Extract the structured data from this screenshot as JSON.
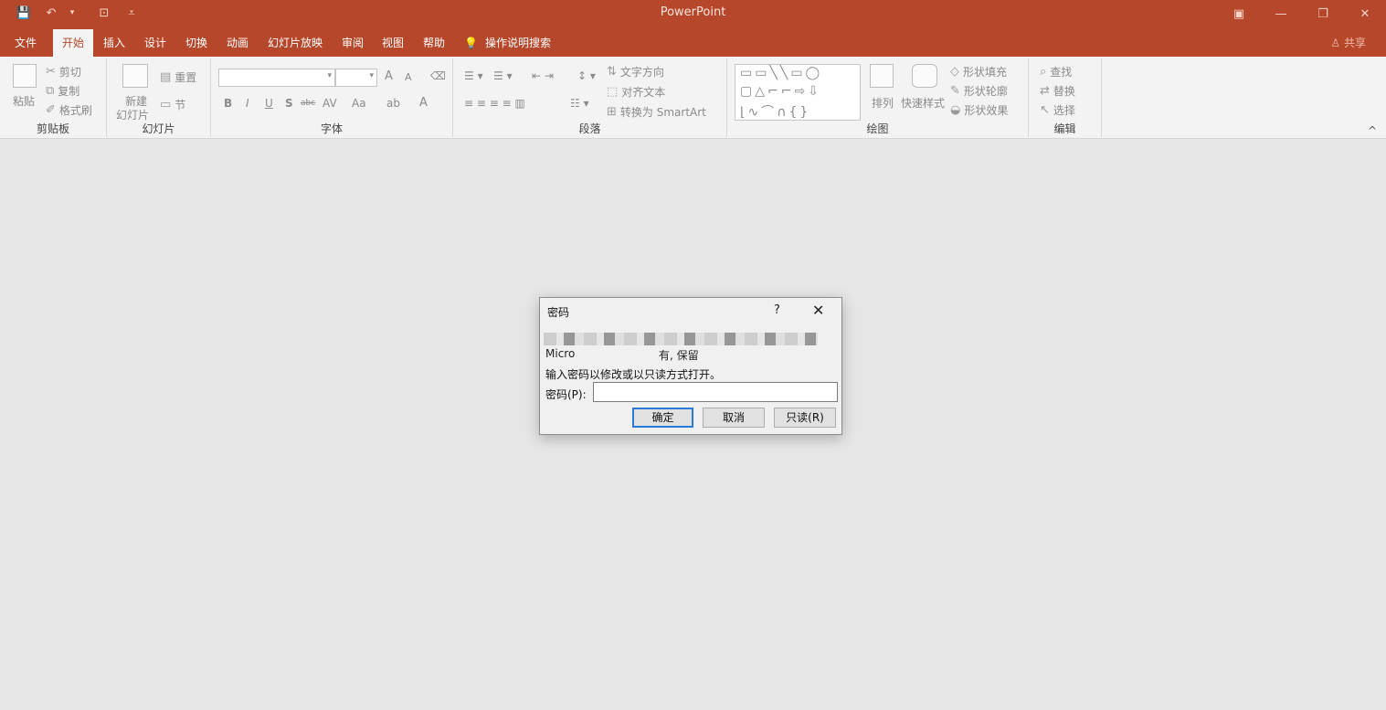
{
  "window": {
    "title": "PowerPoint"
  },
  "qat": {
    "save_icon": "💾",
    "undo_icon": "↶",
    "undo_dd": "▾",
    "present_icon": "⊡",
    "more_icon": "⩡"
  },
  "window_controls": {
    "ribbon_display": "▣",
    "minimize": "—",
    "restore": "❐",
    "close": "✕"
  },
  "tabs": [
    "文件",
    "开始",
    "插入",
    "设计",
    "切换",
    "动画",
    "幻灯片放映",
    "审阅",
    "视图",
    "帮助"
  ],
  "tell_me": {
    "icon": "💡",
    "label": "操作说明搜索"
  },
  "share": "共享",
  "share_icon": "♙",
  "ribbon": {
    "clipboard": {
      "label": "剪贴板",
      "paste": "粘贴",
      "cut": "剪切",
      "copy": "复制",
      "format_painter": "格式刷"
    },
    "slides": {
      "label": "幻灯片",
      "new_slide": "新建",
      "new_slide2": "幻灯片",
      "reset": "重置",
      "section": "节"
    },
    "font": {
      "label": "字体",
      "bold": "B",
      "italic": "I",
      "underline": "U",
      "shadow": "S",
      "strike": "abc",
      "spacing": "AV",
      "case": "Aa",
      "grow": "A",
      "shrink": "A",
      "color": "A"
    },
    "paragraph": {
      "label": "段落",
      "text_direction": "文字方向",
      "align_text": "对齐文本",
      "smartart": "转换为 SmartArt"
    },
    "drawing": {
      "label": "绘图",
      "arrange": "排列",
      "quick_styles": "快速样式",
      "fill": "形状填充",
      "outline": "形状轮廓",
      "effects": "形状效果"
    },
    "editing": {
      "label": "编辑",
      "find": "查找",
      "replace": "替换",
      "select": "选择"
    },
    "collapse": "^"
  },
  "dialog": {
    "title": "密码",
    "help": "?",
    "close": "✕",
    "line1_start": "Micro",
    "line1_end": "有, 保留",
    "instruction": "输入密码以修改或以只读方式打开。",
    "password_label": "密码(P):",
    "password_value": "",
    "ok": "确定",
    "cancel": "取消",
    "readonly": "只读(R)"
  }
}
